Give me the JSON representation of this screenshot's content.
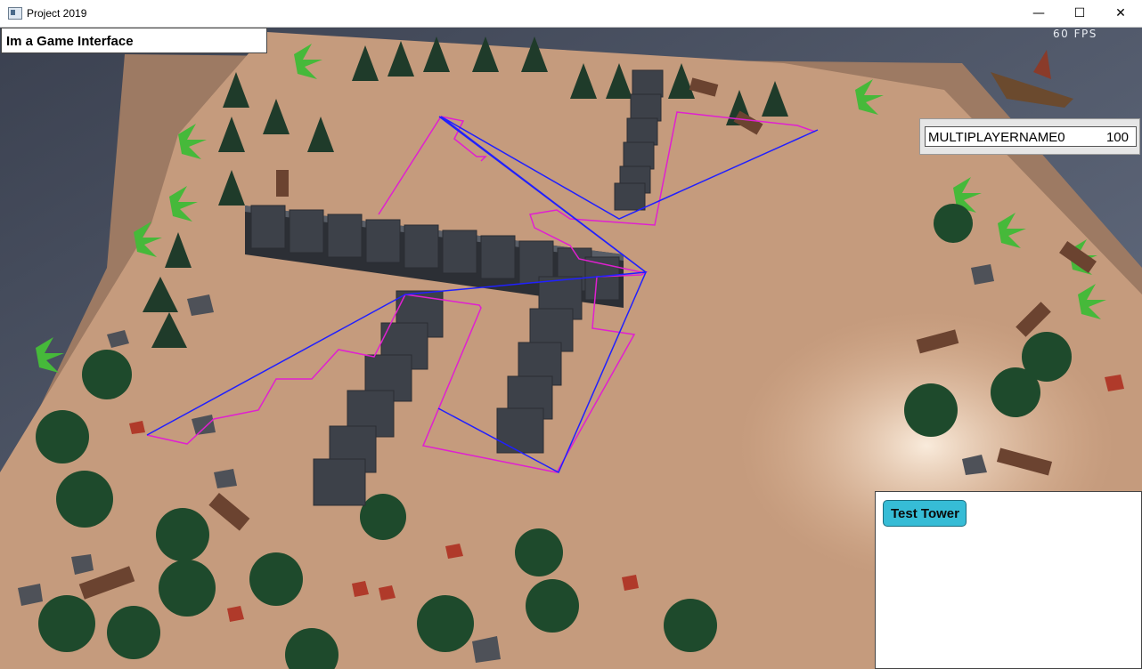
{
  "window": {
    "title": "Project 2019",
    "minimize_glyph": "—",
    "maximize_glyph": "☐",
    "close_glyph": "✕"
  },
  "hud": {
    "title": "Im a Game Interface",
    "fps": "60 FPS"
  },
  "players": [
    {
      "name": "MULTIPLAYERNAME0",
      "score": "100"
    }
  ],
  "build_menu": {
    "buttons": [
      {
        "label": "Test Tower"
      }
    ]
  },
  "colors": {
    "water": "#4a5262",
    "sand": "#c49a7c",
    "tree": "#1f3f2a",
    "wall": "#3d4149",
    "path_magenta": "#e020d0",
    "path_blue": "#2020ff",
    "button": "#36bcd6"
  },
  "icons": [
    "app-icon",
    "minimize-icon",
    "maximize-icon",
    "close-icon"
  ]
}
